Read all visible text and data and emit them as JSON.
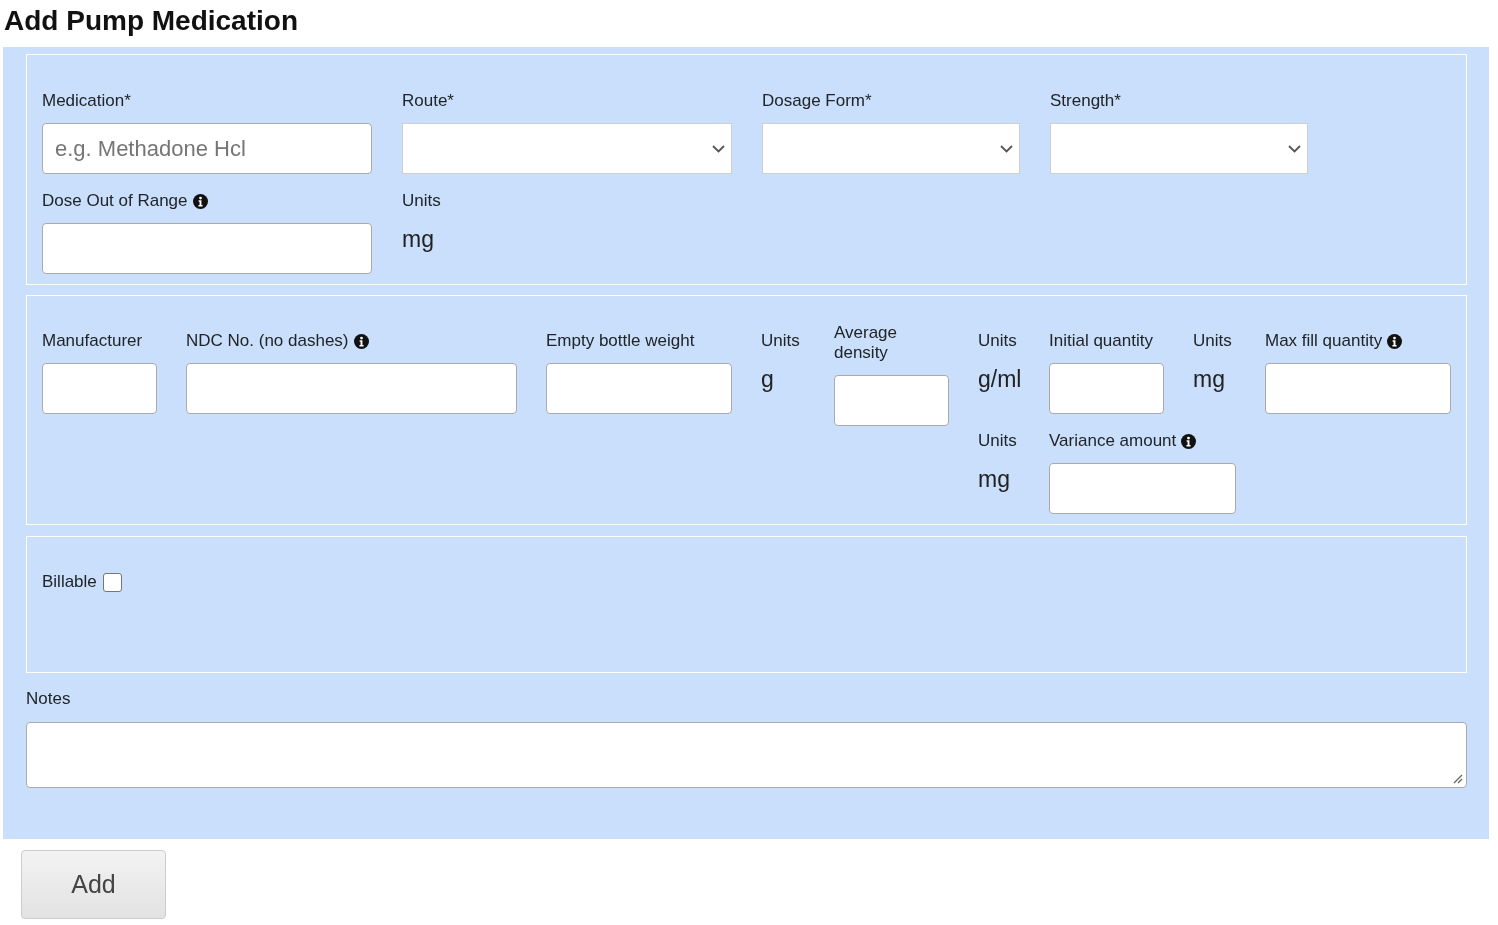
{
  "title": "Add Pump Medication",
  "sections": [
    {
      "fields": [
        {
          "kind": "text",
          "label": "Medication*",
          "placeholder": "e.g. Methadone Hcl"
        },
        {
          "kind": "select",
          "label": "Route*"
        },
        {
          "kind": "select",
          "label": "Dosage Form*"
        },
        {
          "kind": "select",
          "label": "Strength*"
        },
        {
          "kind": "text",
          "label": "Dose Out of Range",
          "info": true
        },
        {
          "kind": "unit",
          "label": "Units",
          "value": "mg"
        }
      ]
    },
    {
      "fields": [
        {
          "kind": "text",
          "label": "Manufacturer"
        },
        {
          "kind": "text",
          "label": "NDC No. (no dashes)",
          "info": true
        },
        {
          "kind": "text",
          "label": "Empty bottle weight"
        },
        {
          "kind": "unit",
          "label": "Units",
          "value": "g"
        },
        {
          "kind": "text",
          "label": "Average density"
        },
        {
          "kind": "unit",
          "label": "Units",
          "value": "g/ml"
        },
        {
          "kind": "text",
          "label": "Initial quantity"
        },
        {
          "kind": "unit",
          "label": "Units",
          "value": "mg"
        },
        {
          "kind": "text",
          "label": "Max fill quantity",
          "info": true
        },
        {
          "kind": "unit",
          "label": "Units",
          "value": "mg"
        },
        {
          "kind": "text",
          "label": "Variance amount",
          "info": true
        }
      ]
    },
    {
      "fields": [
        {
          "kind": "checkbox",
          "label": "Billable",
          "checked": false
        }
      ]
    }
  ],
  "notes": {
    "label": "Notes"
  },
  "submit_button": {
    "label": "Add"
  }
}
